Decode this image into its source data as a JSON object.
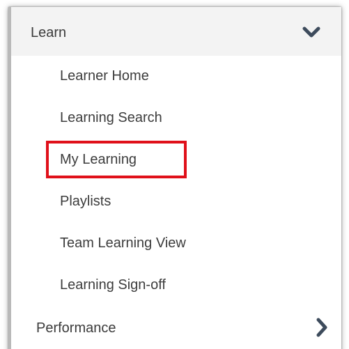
{
  "nav": {
    "header": {
      "label": "Learn",
      "icon": "chevron-down-icon"
    },
    "items": [
      {
        "label": "Learner Home"
      },
      {
        "label": "Learning Search"
      },
      {
        "label": "My Learning",
        "highlighted": true
      },
      {
        "label": "Playlists"
      },
      {
        "label": "Team Learning View"
      },
      {
        "label": "Learning Sign-off"
      }
    ],
    "next_section": {
      "label": "Performance",
      "icon": "chevron-right-icon"
    }
  },
  "colors": {
    "highlight_border": "#e0101a",
    "header_background": "#f3f3f3",
    "text": "#3c3c3c",
    "chevron": "#3d4b5c"
  }
}
